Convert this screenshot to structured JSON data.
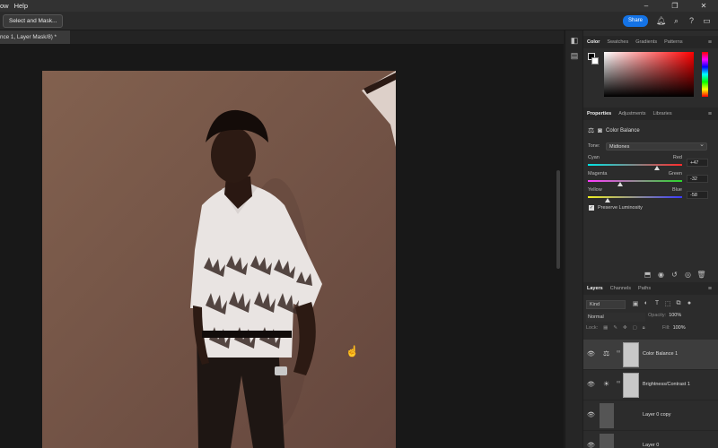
{
  "menu": {
    "items": [
      "ow",
      "Help"
    ]
  },
  "window_controls": [
    "–",
    "❐",
    "✕"
  ],
  "options_bar": {
    "select_mask_label": "Select and Mask...",
    "share_label": "Share"
  },
  "document": {
    "tab_title": "nce 1, Layer Mask/8) *"
  },
  "panels": {
    "color_tabs": [
      "Color",
      "Swatches",
      "Gradients",
      "Patterns"
    ],
    "properties_tabs": [
      "Properties",
      "Adjustments",
      "Libraries"
    ],
    "properties": {
      "title": "Color Balance",
      "tone_label": "Tone:",
      "tone_value": "Midtones",
      "sliders": [
        {
          "left": "Cyan",
          "right": "Red",
          "value": "+47",
          "level": 0.73,
          "gradient": [
            "#00e5e5",
            "#ff2b2b"
          ]
        },
        {
          "left": "Magenta",
          "right": "Green",
          "value": "-32",
          "level": 0.34,
          "gradient": [
            "#ff3bff",
            "#2bd92b"
          ]
        },
        {
          "left": "Yellow",
          "right": "Blue",
          "value": "-58",
          "level": 0.21,
          "gradient": [
            "#f0f020",
            "#3a3aff"
          ]
        }
      ],
      "preserve_label": "Preserve Luminosity"
    },
    "layers_tabs": [
      "Layers",
      "Channels",
      "Paths"
    ],
    "layers_controls": {
      "kind_label": "Kind",
      "blend_mode": "Normal",
      "opacity_label": "Opacity:",
      "opacity_value": "100%",
      "lock_label": "Lock:",
      "fill_label": "Fill:",
      "fill_value": "100%"
    },
    "layers": [
      {
        "name": "Color Balance 1",
        "selected": true
      },
      {
        "name": "Brightness/Contrast 1",
        "selected": false
      },
      {
        "name": "Layer 0 copy",
        "selected": false
      },
      {
        "name": "Layer 0",
        "selected": false
      }
    ]
  }
}
